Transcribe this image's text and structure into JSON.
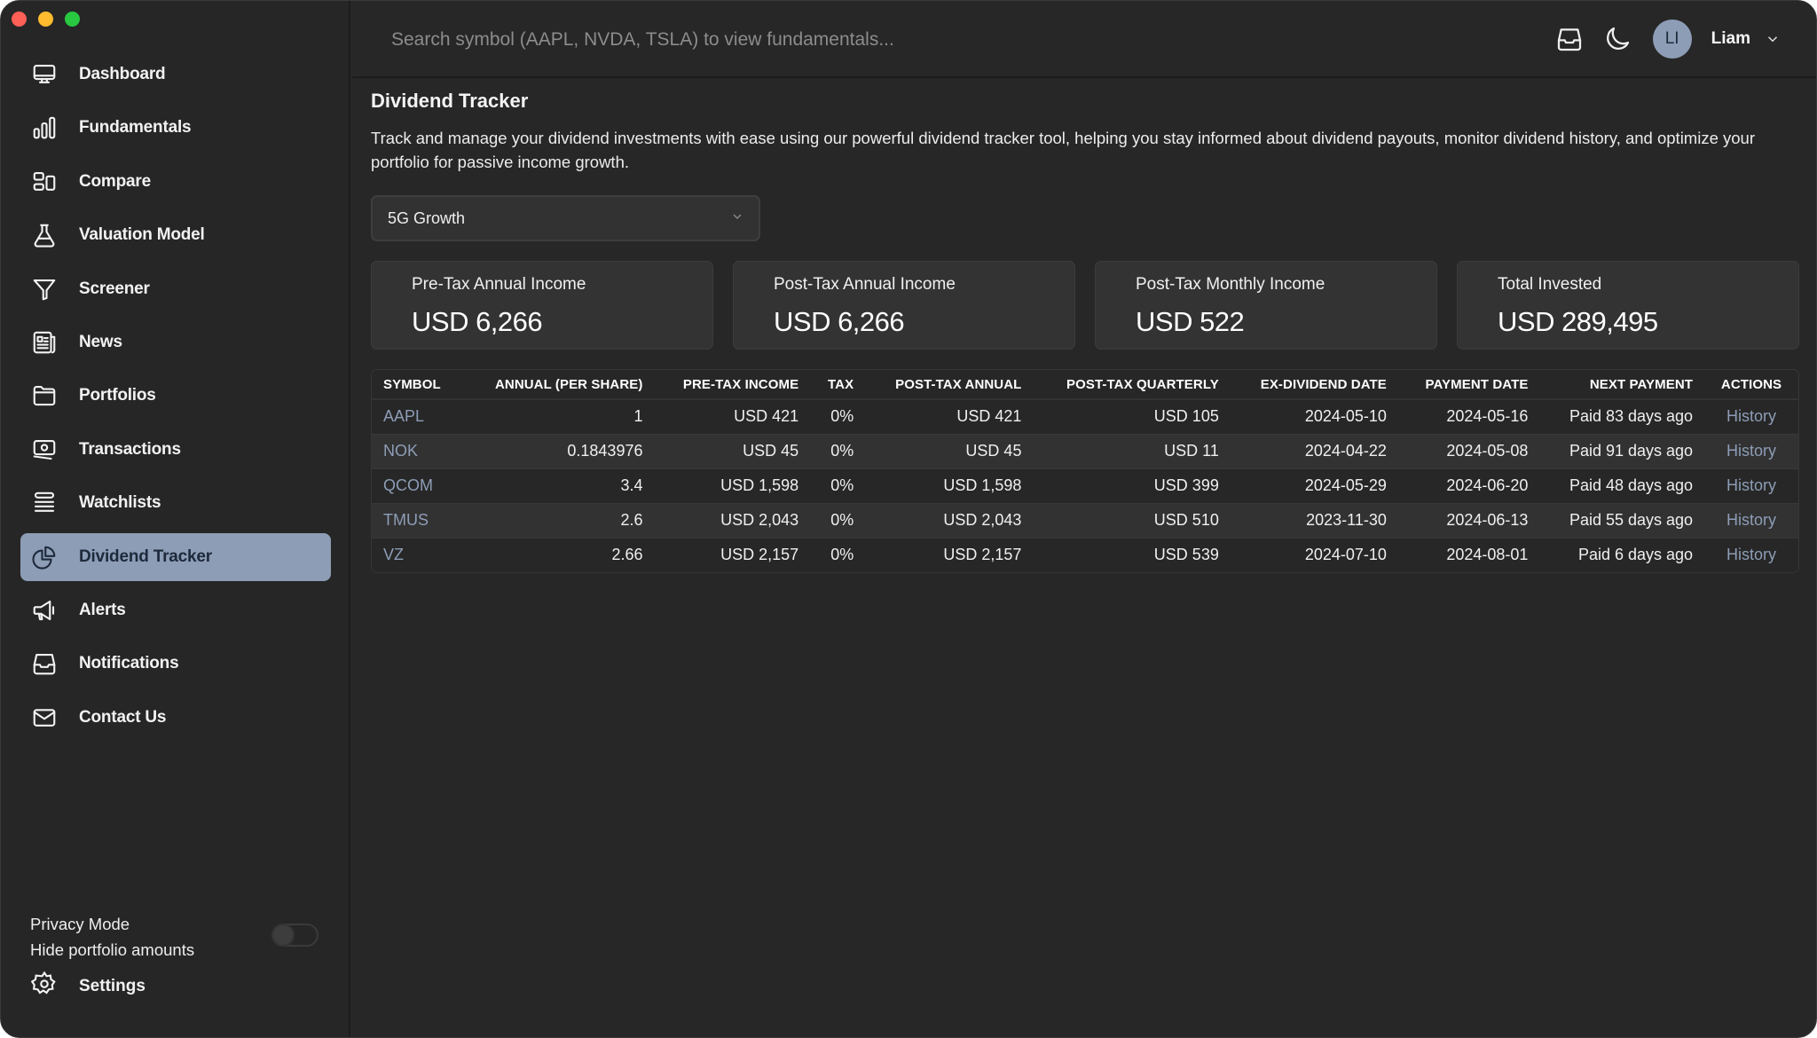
{
  "window": {
    "traffic_lights": [
      "close",
      "minimize",
      "maximize"
    ]
  },
  "sidebar": {
    "items": [
      {
        "label": "Dashboard",
        "icon": "monitor-icon",
        "active": false
      },
      {
        "label": "Fundamentals",
        "icon": "bar-chart-icon",
        "active": false
      },
      {
        "label": "Compare",
        "icon": "compare-layout-icon",
        "active": false
      },
      {
        "label": "Valuation Model",
        "icon": "flask-icon",
        "active": false
      },
      {
        "label": "Screener",
        "icon": "funnel-icon",
        "active": false
      },
      {
        "label": "News",
        "icon": "newspaper-icon",
        "active": false
      },
      {
        "label": "Portfolios",
        "icon": "folder-icon",
        "active": false
      },
      {
        "label": "Transactions",
        "icon": "banknote-icon",
        "active": false
      },
      {
        "label": "Watchlists",
        "icon": "list-stack-icon",
        "active": false
      },
      {
        "label": "Dividend Tracker",
        "icon": "pie-chart-icon",
        "active": true
      },
      {
        "label": "Alerts",
        "icon": "megaphone-icon",
        "active": false
      },
      {
        "label": "Notifications",
        "icon": "inbox-icon",
        "active": false
      },
      {
        "label": "Contact Us",
        "icon": "envelope-icon",
        "active": false
      }
    ],
    "privacy": {
      "title": "Privacy Mode",
      "subtitle": "Hide portfolio amounts",
      "enabled": false
    },
    "settings_label": "Settings"
  },
  "topbar": {
    "search_placeholder": "Search symbol (AAPL, NVDA, TSLA) to view fundamentals...",
    "search_value": "",
    "inbox_icon": "inbox-icon",
    "theme_icon": "moon-icon",
    "avatar_initials": "LI",
    "username": "Liam"
  },
  "main": {
    "title": "Dividend Tracker",
    "description": "Track and manage your dividend investments with ease using our powerful dividend tracker tool, helping you stay informed about dividend payouts, monitor dividend history, and optimize your portfolio for passive income growth.",
    "portfolio_select": {
      "selected": "5G Growth"
    },
    "cards": [
      {
        "label": "Pre-Tax Annual Income",
        "value": "USD 6,266"
      },
      {
        "label": "Post-Tax Annual Income",
        "value": "USD 6,266"
      },
      {
        "label": "Post-Tax Monthly Income",
        "value": "USD 522"
      },
      {
        "label": "Total Invested",
        "value": "USD 289,495"
      }
    ],
    "table": {
      "headers": [
        "Symbol",
        "Annual (Per Share)",
        "Pre-Tax Income",
        "Tax",
        "Post-Tax Annual",
        "Post-Tax Quarterly",
        "Ex-Dividend Date",
        "Payment Date",
        "Next Payment",
        "Actions"
      ],
      "rows": [
        {
          "symbol": "AAPL",
          "annual": "1",
          "pretax": "USD 421",
          "tax": "0%",
          "posttax_annual": "USD 421",
          "posttax_quarterly": "USD 105",
          "ex_date": "2024-05-10",
          "pay_date": "2024-05-16",
          "next_payment": "Paid 83 days ago",
          "action": "History"
        },
        {
          "symbol": "NOK",
          "annual": "0.1843976",
          "pretax": "USD 45",
          "tax": "0%",
          "posttax_annual": "USD 45",
          "posttax_quarterly": "USD 11",
          "ex_date": "2024-04-22",
          "pay_date": "2024-05-08",
          "next_payment": "Paid 91 days ago",
          "action": "History"
        },
        {
          "symbol": "QCOM",
          "annual": "3.4",
          "pretax": "USD 1,598",
          "tax": "0%",
          "posttax_annual": "USD 1,598",
          "posttax_quarterly": "USD 399",
          "ex_date": "2024-05-29",
          "pay_date": "2024-06-20",
          "next_payment": "Paid 48 days ago",
          "action": "History"
        },
        {
          "symbol": "TMUS",
          "annual": "2.6",
          "pretax": "USD 2,043",
          "tax": "0%",
          "posttax_annual": "USD 2,043",
          "posttax_quarterly": "USD 510",
          "ex_date": "2023-11-30",
          "pay_date": "2024-06-13",
          "next_payment": "Paid 55 days ago",
          "action": "History"
        },
        {
          "symbol": "VZ",
          "annual": "2.66",
          "pretax": "USD 2,157",
          "tax": "0%",
          "posttax_annual": "USD 2,157",
          "posttax_quarterly": "USD 539",
          "ex_date": "2024-07-10",
          "pay_date": "2024-08-01",
          "next_payment": "Paid 6 days ago",
          "action": "History"
        }
      ]
    }
  },
  "colors": {
    "accent": "#8d9db6",
    "background": "#272727",
    "card": "#333333"
  }
}
